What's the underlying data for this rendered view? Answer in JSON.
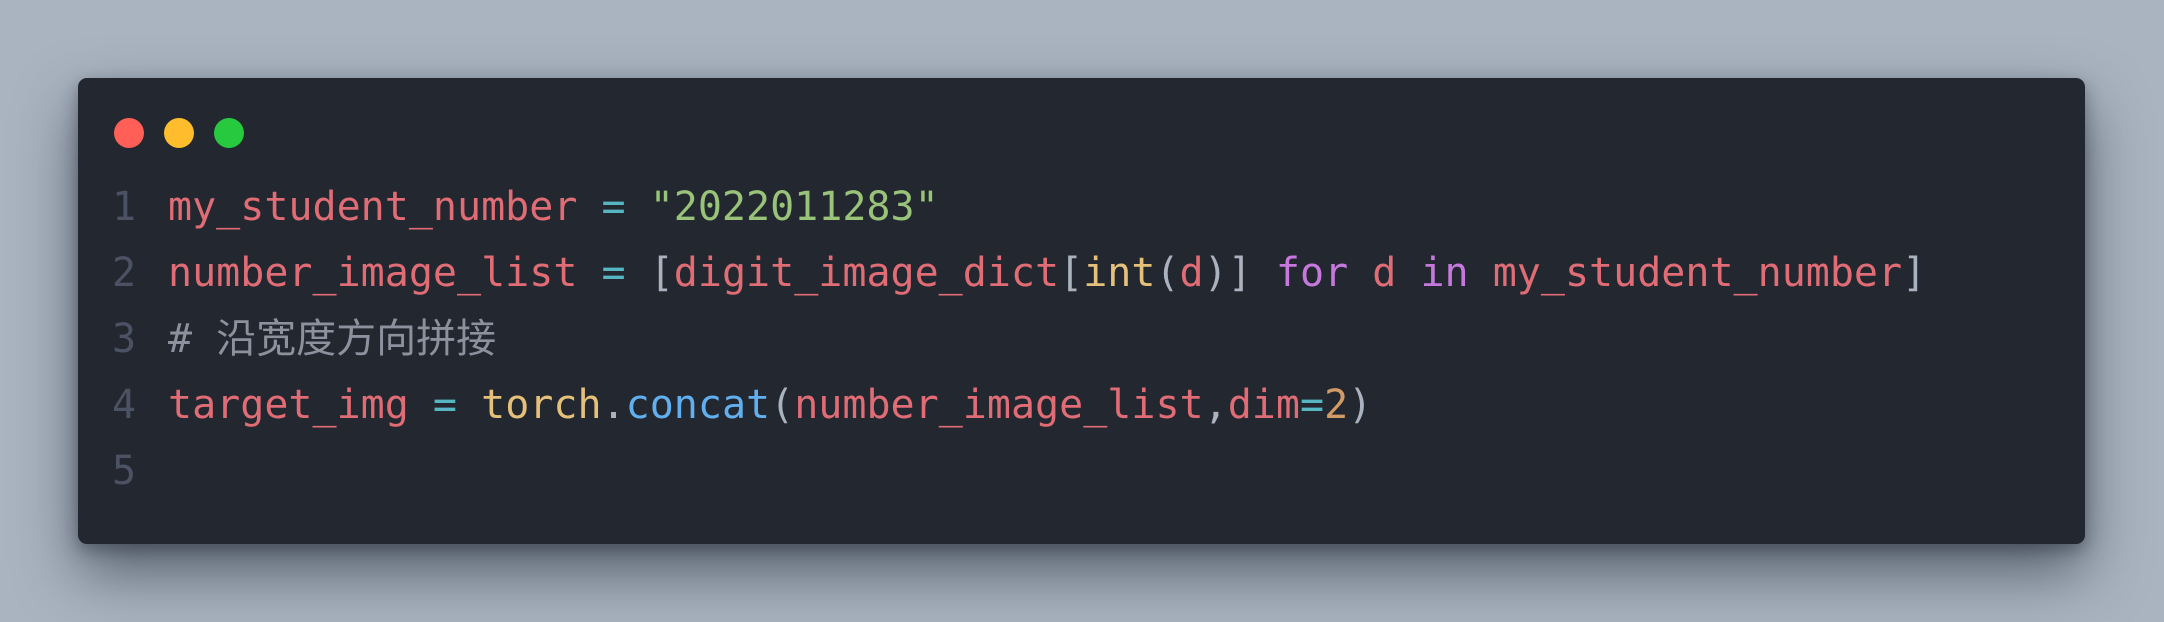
{
  "colors": {
    "background": "#a9b4c0",
    "window": "#23272f",
    "line_number": "#4b5263",
    "close": "#ff5f56",
    "minimize": "#ffbd2e",
    "zoom": "#27c93f"
  },
  "window_controls": [
    {
      "icon": "close-dot-icon",
      "color": "#ff5f56"
    },
    {
      "icon": "minimize-dot-icon",
      "color": "#ffbd2e"
    },
    {
      "icon": "zoom-dot-icon",
      "color": "#27c93f"
    }
  ],
  "code": {
    "lines": [
      {
        "number": "1",
        "tokens": [
          {
            "text": "my_student_number",
            "color": "#e06c75"
          },
          {
            "text": " ",
            "color": "#abb2bf"
          },
          {
            "text": "=",
            "color": "#56b6c2"
          },
          {
            "text": " ",
            "color": "#abb2bf"
          },
          {
            "text": "\"2022011283\"",
            "color": "#98c379"
          }
        ]
      },
      {
        "number": "2",
        "tokens": [
          {
            "text": "number_image_list",
            "color": "#e06c75"
          },
          {
            "text": " ",
            "color": "#abb2bf"
          },
          {
            "text": "=",
            "color": "#56b6c2"
          },
          {
            "text": " ",
            "color": "#abb2bf"
          },
          {
            "text": "[",
            "color": "#abb2bf"
          },
          {
            "text": "digit_image_dict",
            "color": "#e06c75"
          },
          {
            "text": "[",
            "color": "#abb2bf"
          },
          {
            "text": "int",
            "color": "#e5c07b"
          },
          {
            "text": "(",
            "color": "#abb2bf"
          },
          {
            "text": "d",
            "color": "#e06c75"
          },
          {
            "text": ")",
            "color": "#abb2bf"
          },
          {
            "text": "]",
            "color": "#abb2bf"
          },
          {
            "text": " ",
            "color": "#abb2bf"
          },
          {
            "text": "for",
            "color": "#c678dd"
          },
          {
            "text": " ",
            "color": "#abb2bf"
          },
          {
            "text": "d",
            "color": "#e06c75"
          },
          {
            "text": " ",
            "color": "#abb2bf"
          },
          {
            "text": "in",
            "color": "#c678dd"
          },
          {
            "text": " ",
            "color": "#abb2bf"
          },
          {
            "text": "my_student_number",
            "color": "#e06c75"
          },
          {
            "text": "]",
            "color": "#abb2bf"
          }
        ]
      },
      {
        "number": "3",
        "tokens": [
          {
            "text": "# 沿宽度方向拼接",
            "color": "#8b929e"
          }
        ]
      },
      {
        "number": "4",
        "tokens": [
          {
            "text": "target_img",
            "color": "#e06c75"
          },
          {
            "text": " ",
            "color": "#abb2bf"
          },
          {
            "text": "=",
            "color": "#56b6c2"
          },
          {
            "text": " ",
            "color": "#abb2bf"
          },
          {
            "text": "torch",
            "color": "#e5c07b"
          },
          {
            "text": ".",
            "color": "#abb2bf"
          },
          {
            "text": "concat",
            "color": "#61afef"
          },
          {
            "text": "(",
            "color": "#abb2bf"
          },
          {
            "text": "number_image_list",
            "color": "#e06c75"
          },
          {
            "text": ",",
            "color": "#abb2bf"
          },
          {
            "text": "dim",
            "color": "#e06c75"
          },
          {
            "text": "=",
            "color": "#56b6c2"
          },
          {
            "text": "2",
            "color": "#d19a66"
          },
          {
            "text": ")",
            "color": "#abb2bf"
          }
        ]
      },
      {
        "number": "5",
        "tokens": []
      }
    ]
  }
}
